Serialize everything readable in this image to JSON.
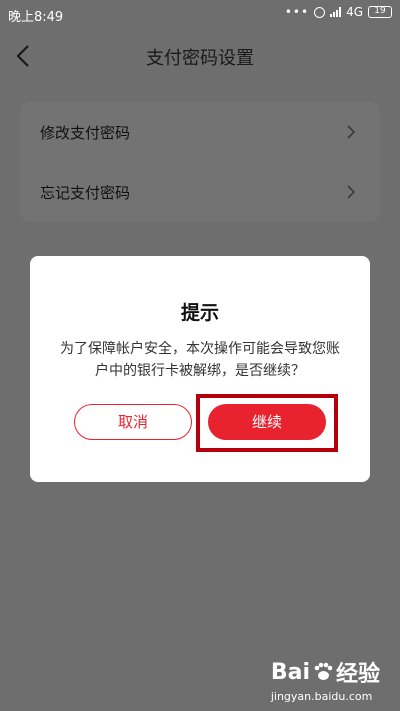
{
  "status_bar": {
    "time": "晚上8:49",
    "dots": "•••",
    "network": "4G",
    "battery": "19"
  },
  "nav": {
    "title": "支付密码设置"
  },
  "menu": {
    "items": [
      {
        "label": "修改支付密码"
      },
      {
        "label": "忘记支付密码"
      }
    ]
  },
  "dialog": {
    "title": "提示",
    "message": "为了保障帐户安全，本次操作可能会导致您账户中的银行卡被解绑，是否继续？",
    "cancel_label": "取消",
    "continue_label": "继续"
  },
  "watermark": {
    "brand_prefix": "Bai",
    "brand_suffix": "经验",
    "domain": "jingyan.baidu.com"
  },
  "colors": {
    "accent": "#e8232f",
    "highlight": "#b3000c",
    "overlay": "#6e6e6e"
  }
}
